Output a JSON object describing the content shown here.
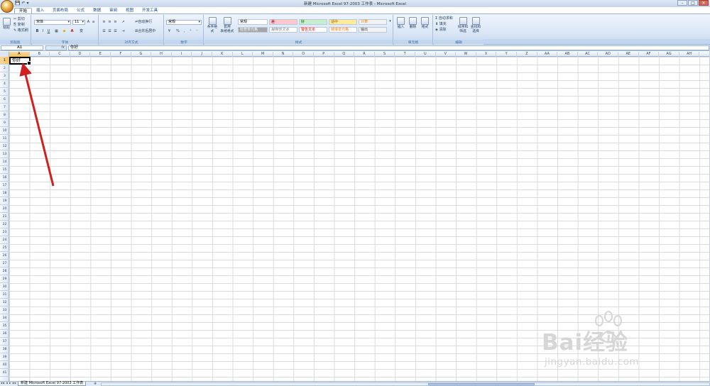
{
  "window": {
    "title": "新建 Microsoft Excel 97-2003 工作表 - Microsoft Excel",
    "controls": [
      "–",
      "□",
      "✕"
    ]
  },
  "qat": {
    "save": "💾",
    "undo": "↶",
    "dropdown": "▾"
  },
  "tabs": [
    "开始",
    "插入",
    "页面布局",
    "公式",
    "数据",
    "审阅",
    "视图",
    "开发工具"
  ],
  "clipboard": {
    "paste": "粘贴",
    "cut": "剪切",
    "copy": "复制",
    "format_painter": "格式刷",
    "label": "剪贴板"
  },
  "font": {
    "name": "宋体",
    "size": "11",
    "bold": "B",
    "italic": "I",
    "underline": "U",
    "label": "字体"
  },
  "alignment": {
    "wrap": "自动换行",
    "merge": "合并后居中",
    "label": "对齐方式"
  },
  "number": {
    "format": "常规",
    "percent": "%",
    "comma": ",",
    "label": "数字"
  },
  "conditional": {
    "cond_format": "条件格式",
    "table_format": "套用\n表格格式"
  },
  "styles": {
    "items": [
      {
        "label": "常规",
        "bg": "#ffffff",
        "fg": "#000000"
      },
      {
        "label": "差",
        "bg": "#ffc7ce",
        "fg": "#9c0006"
      },
      {
        "label": "好",
        "bg": "#c6efce",
        "fg": "#006100"
      },
      {
        "label": "适中",
        "bg": "#ffeb9c",
        "fg": "#9c6500"
      },
      {
        "label": "计算",
        "bg": "#f2f2f2",
        "fg": "#fa7d00"
      },
      {
        "label": "检查单元格",
        "bg": "#a5a5a5",
        "fg": "#ffffff"
      },
      {
        "label": "解释性文本",
        "bg": "#ffffff",
        "fg": "#7f7f7f"
      },
      {
        "label": "警告文本",
        "bg": "#ffffff",
        "fg": "#ff0000"
      },
      {
        "label": "链接单元格",
        "bg": "#ffffff",
        "fg": "#fa7d00"
      },
      {
        "label": "输出",
        "bg": "#f2f2f2",
        "fg": "#3f3f3f"
      }
    ],
    "label": "样式"
  },
  "cells_group": {
    "insert": "插入",
    "delete": "删除",
    "format": "格式",
    "label": "单元格"
  },
  "editing": {
    "autosum": "自动求和",
    "fill": "填充",
    "clear": "清除",
    "sort": "排序和\n筛选",
    "find": "查找和\n选择",
    "label": "编辑"
  },
  "formula_bar": {
    "name_box": "A1",
    "fx": "fx",
    "value": "你好"
  },
  "columns": [
    "A",
    "B",
    "C",
    "D",
    "E",
    "F",
    "G",
    "H",
    "I",
    "J",
    "K",
    "L",
    "M",
    "N",
    "O",
    "P",
    "Q",
    "R",
    "S",
    "T",
    "U",
    "V",
    "W",
    "X",
    "Y",
    "Z",
    "AA",
    "AB",
    "AC",
    "AD",
    "AE",
    "AF",
    "AG",
    "AH"
  ],
  "rows": [
    "1",
    "2",
    "3",
    "4",
    "5",
    "6",
    "7",
    "8",
    "9",
    "10",
    "11",
    "12",
    "13",
    "14",
    "15",
    "16",
    "17",
    "18",
    "19",
    "20",
    "21",
    "22",
    "23",
    "24",
    "25",
    "26",
    "27",
    "28",
    "29",
    "30",
    "31",
    "32",
    "33",
    "34",
    "35",
    "36",
    "37",
    "38",
    "39",
    "40",
    "41"
  ],
  "active_cell": {
    "ref": "A1",
    "value": "你好"
  },
  "sheet": {
    "nav": "◂◂ ◂ ▸ ▸▸",
    "name": "新建 Microsoft Excel 97-2003 工作表",
    "add": "✚"
  },
  "watermark": {
    "text": "Bai经验",
    "url": "jingyan.baidu.com"
  },
  "colors": {
    "accent": "#8db2e3",
    "arrow": "#d01f1f",
    "selected_header": "#f1c15f"
  }
}
